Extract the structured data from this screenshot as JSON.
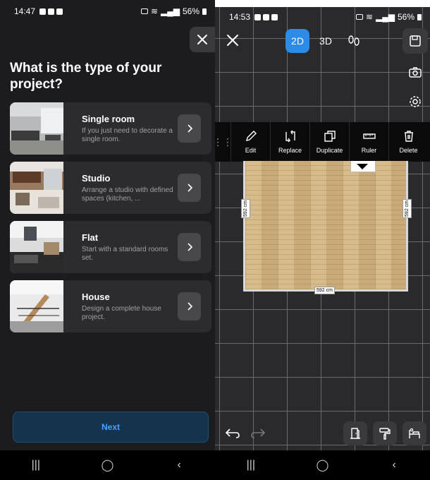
{
  "left": {
    "status": {
      "time": "14:47",
      "battery": "56%"
    },
    "title": "What is the type of your project?",
    "cards": [
      {
        "title": "Single room",
        "desc": "If you just need to decorate a single room."
      },
      {
        "title": "Studio",
        "desc": "Arrange a studio with defined spaces (kitchen, ..."
      },
      {
        "title": "Flat",
        "desc": "Start with a standard rooms set."
      },
      {
        "title": "House",
        "desc": "Design a complete house project."
      }
    ],
    "next_label": "Next"
  },
  "right": {
    "status": {
      "time": "14:53",
      "battery": "56%"
    },
    "view_modes": [
      "2D",
      "3D"
    ],
    "tools": [
      {
        "label": "Edit",
        "icon": "pencil-icon"
      },
      {
        "label": "Replace",
        "icon": "replace-icon"
      },
      {
        "label": "Duplicate",
        "icon": "duplicate-icon"
      },
      {
        "label": "Ruler",
        "icon": "ruler-icon"
      },
      {
        "label": "Delete",
        "icon": "trash-icon"
      }
    ],
    "dimensions": {
      "left": "592 cm",
      "right": "592 cm",
      "bottom": "592 cm"
    }
  },
  "colors": {
    "accent": "#2b8be6",
    "next_text": "#4aa3ff",
    "floor": "#c9ae7d"
  }
}
